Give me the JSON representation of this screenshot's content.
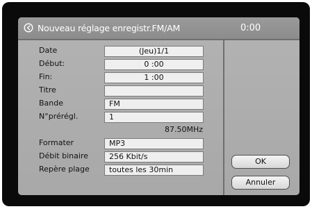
{
  "dialog": {
    "title": "Nouveau réglage enregistr.FM/AM",
    "clock": "0:00",
    "back_icon": "back-arrow-circle-icon"
  },
  "fields": [
    {
      "label": "Date",
      "value": "(Jeu)1/1"
    },
    {
      "label": "Début:",
      "value": "0  :00"
    },
    {
      "label": "Fin:",
      "value": "1  :00"
    },
    {
      "label": "Titre",
      "value": ""
    },
    {
      "label": "Bande",
      "value": "FM"
    },
    {
      "label": "N°prérégl.",
      "value": "1"
    }
  ],
  "frequency": "87.50MHz",
  "fields2": [
    {
      "label": "Formater",
      "value": "MP3"
    },
    {
      "label": "Débit binaire",
      "value": "256 Kbit/s"
    },
    {
      "label": "Repère plage",
      "value": "toutes les 30min"
    }
  ],
  "buttons": {
    "ok": "OK",
    "cancel": "Annuler"
  }
}
